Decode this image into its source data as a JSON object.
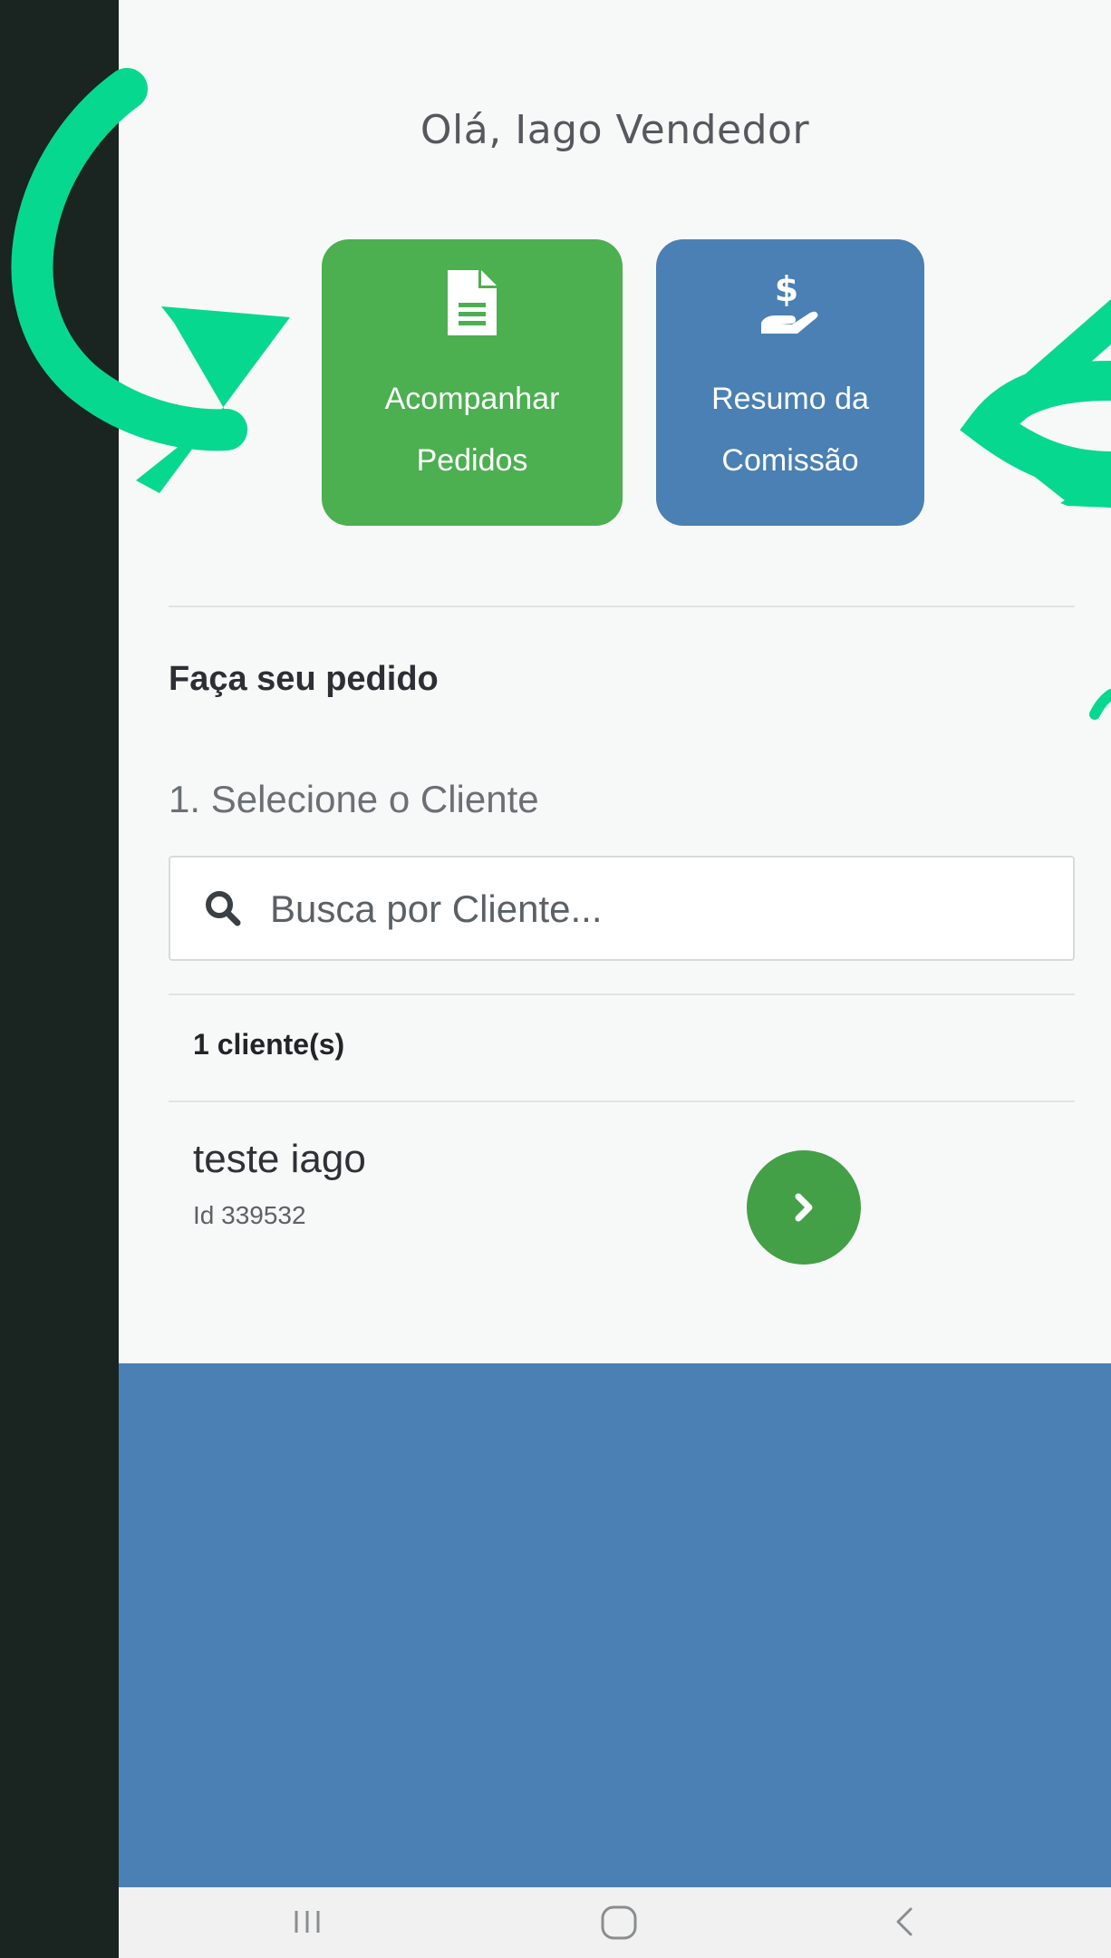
{
  "greeting": "Olá, Iago Vendedor",
  "tiles": [
    {
      "line1": "Acompanhar",
      "line2": "Pedidos",
      "icon": "document-icon",
      "color": "#4caf50"
    },
    {
      "line1": "Resumo da",
      "line2": "Comissão",
      "icon": "hand-dollar-icon",
      "color": "#4a80b3"
    }
  ],
  "order": {
    "title": "Faça seu pedido",
    "step": "1. Selecione o Cliente",
    "search_placeholder": "Busca por Cliente...",
    "count": "1 cliente(s)",
    "clients": [
      {
        "name": "teste iago",
        "id": "Id 339532"
      }
    ]
  },
  "colors": {
    "arrow": "#07d88f",
    "band": "#4a80b3",
    "go_button": "#43a047"
  },
  "system_nav": {
    "recents": "recents-icon",
    "home": "home-icon",
    "back": "back-icon"
  }
}
